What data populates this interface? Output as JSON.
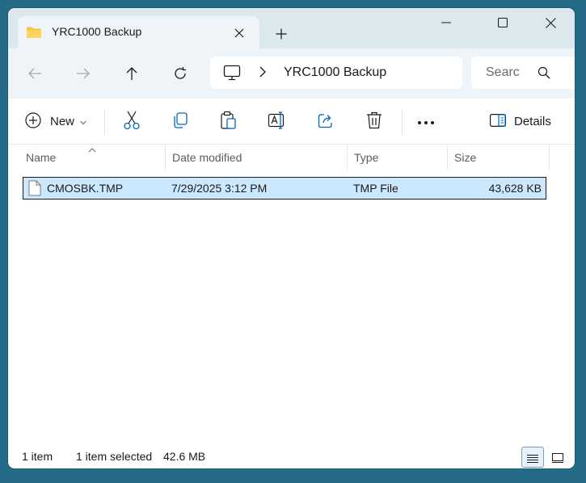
{
  "tab": {
    "title": "YRC1000 Backup",
    "icon": "folder-icon"
  },
  "window_controls": {
    "minimize": "minimize-icon",
    "maximize": "maximize-icon",
    "close": "close-icon"
  },
  "address": {
    "root_icon": "this-pc-icon",
    "crumb": "YRC1000 Backup"
  },
  "search": {
    "placeholder": "Search"
  },
  "toolbar": {
    "new_label": "New",
    "details_label": "Details"
  },
  "columns": {
    "name": "Name",
    "date": "Date modified",
    "type": "Type",
    "size": "Size"
  },
  "files": [
    {
      "name": "CMOSBK.TMP",
      "date": "7/29/2025 3:12 PM",
      "type": "TMP File",
      "size": "43,628 KB",
      "selected": true
    }
  ],
  "status": {
    "count": "1 item",
    "selection": "1 item selected",
    "selection_size": "42.6 MB"
  },
  "colors": {
    "accent": "#0067c0",
    "selection": "#cce8ff",
    "titlebar": "#dbe9ee",
    "desktop": "#256a86"
  }
}
